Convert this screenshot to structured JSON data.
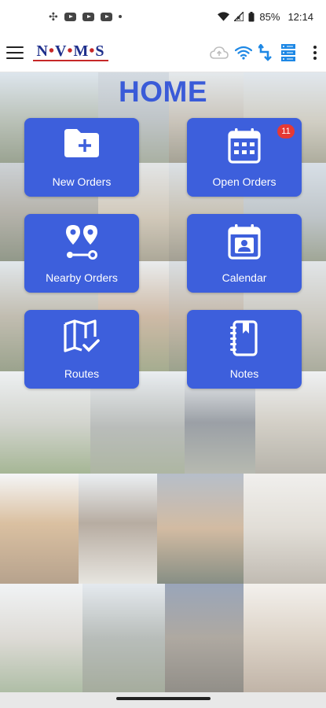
{
  "status_bar": {
    "battery": "85%",
    "time": "12:14"
  },
  "app_bar": {
    "logo_letters": [
      "N",
      "V",
      "M",
      "S"
    ],
    "logo_separator": "•",
    "icons": [
      "menu-icon",
      "cloud-upload-icon",
      "wifi-icon",
      "sync-icon",
      "server-icon",
      "more-vert-icon"
    ]
  },
  "home": {
    "title": "HOME",
    "cards": [
      {
        "label": "New Orders",
        "icon": "folder-add-icon"
      },
      {
        "label": "Open Orders",
        "icon": "calendar-grid-icon",
        "badge": "11"
      },
      {
        "label": "Nearby Orders",
        "icon": "location-pins-icon"
      },
      {
        "label": "Calendar",
        "icon": "calendar-person-icon"
      },
      {
        "label": "Routes",
        "icon": "map-check-icon"
      },
      {
        "label": "Notes",
        "icon": "notebook-icon"
      }
    ]
  },
  "colors": {
    "accent": "#3d5fdc",
    "title": "#3a5bd8",
    "badge": "#e53935",
    "logo_blue": "#1e2f8c",
    "logo_red": "#c62828"
  }
}
